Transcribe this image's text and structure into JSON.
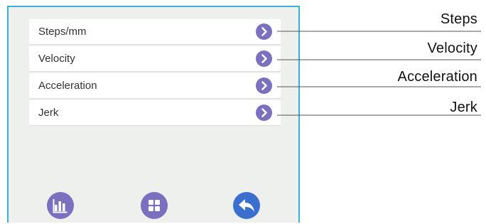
{
  "colors": {
    "accent": "#7b6fc0",
    "screen_border": "#3aaed8",
    "screen_bg": "#eef0ed",
    "line": "#555555"
  },
  "menu": {
    "items": [
      {
        "label": "Steps/mm",
        "icon": "chevron-right-icon"
      },
      {
        "label": "Velocity",
        "icon": "chevron-right-icon"
      },
      {
        "label": "Acceleration",
        "icon": "chevron-right-icon"
      },
      {
        "label": "Jerk",
        "icon": "chevron-right-icon"
      }
    ]
  },
  "toolbar": {
    "buttons": [
      {
        "icon": "bar-chart-icon"
      },
      {
        "icon": "grid-icon"
      },
      {
        "icon": "back-arrow-icon"
      }
    ]
  },
  "callouts": {
    "labels": [
      "Steps",
      "Velocity",
      "Acceleration",
      "Jerk"
    ]
  }
}
